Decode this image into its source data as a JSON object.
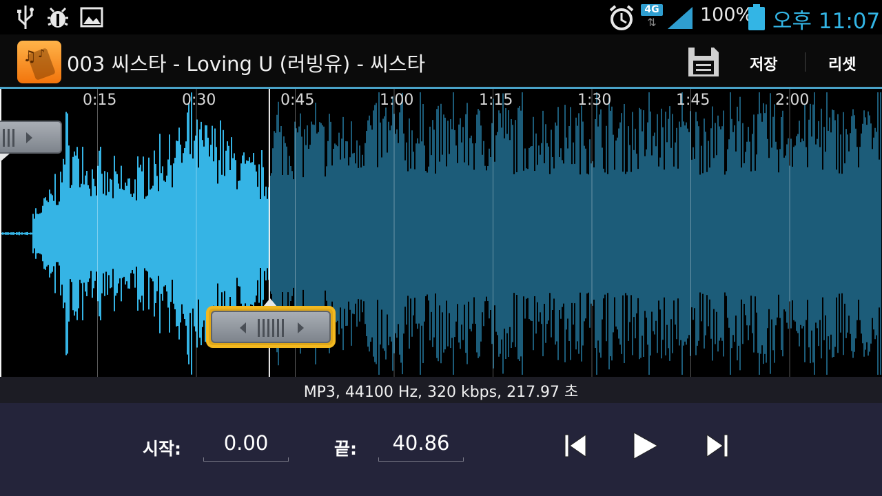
{
  "status_bar": {
    "icons_left": [
      "usb-icon",
      "debug-icon",
      "image-icon"
    ],
    "icons_right": [
      "alarm-icon",
      "4g-icon",
      "signal-icon",
      "battery-icon"
    ],
    "network": "4G",
    "battery": "100%",
    "clock": "오후 11:07"
  },
  "action_bar": {
    "app_icon": "ringtone-app-icon",
    "title": "003 씨스타 - Loving U (러빙유) - 씨스타",
    "save_label": "저장",
    "reset_label": "리셋"
  },
  "waveform": {
    "tick_labels": [
      "0:15",
      "0:30",
      "0:45",
      "1:00",
      "1:15",
      "1:30",
      "1:45",
      "2:00"
    ],
    "selected_color": "#35b4e5",
    "unselected_color": "#1c5c79",
    "start_marker_seconds": 0.0,
    "end_marker_seconds": 40.86
  },
  "file_info": "MP3, 44100 Hz, 320 kbps, 217.97 초",
  "controls": {
    "start_label": "시작:",
    "start_value": "0.00",
    "end_label": "끝:",
    "end_value": "40.86",
    "buttons": [
      "previous-icon",
      "play-icon",
      "next-icon"
    ]
  }
}
